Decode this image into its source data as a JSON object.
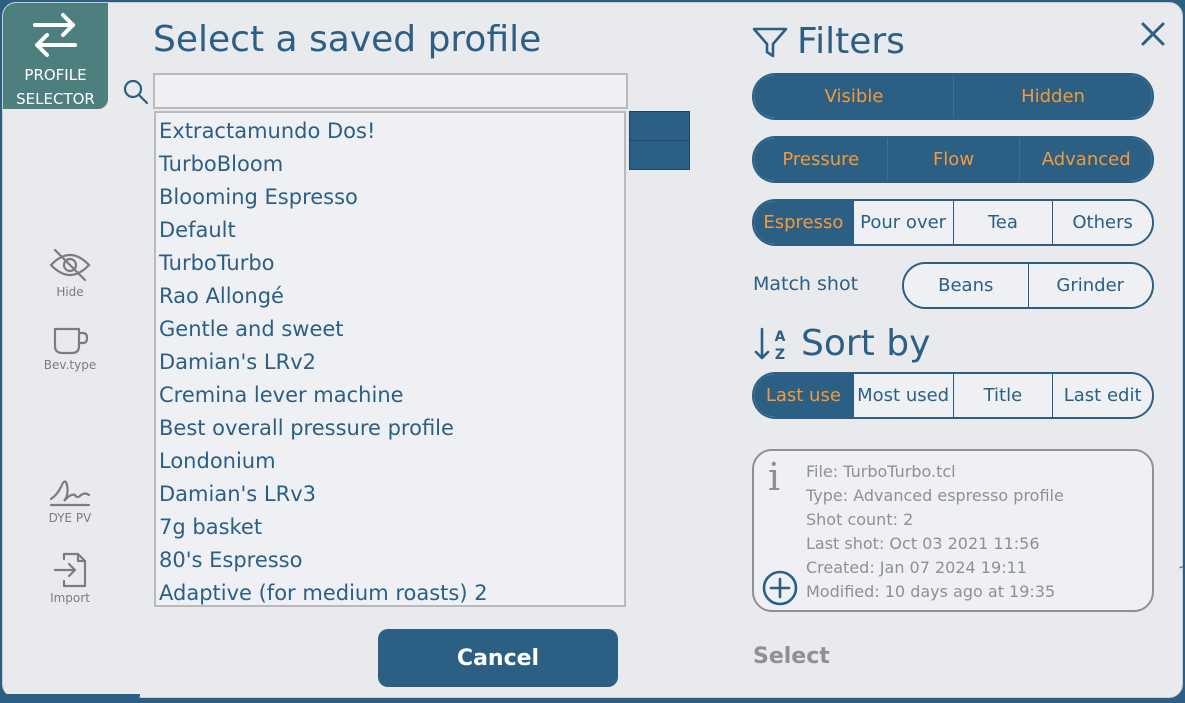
{
  "profile_selector": {
    "label": "PROFILE\nSELECTOR",
    "icon": "swap-arrows-icon"
  },
  "title": "Select a saved profile",
  "search": {
    "value": "",
    "placeholder": ""
  },
  "profiles": [
    "Extractamundo Dos!",
    "TurboBloom",
    "Blooming Espresso",
    "Default",
    "TurboTurbo",
    "Rao Allongé",
    "Gentle and sweet",
    "Damian's LRv2",
    "Cremina lever machine",
    "Best overall pressure profile",
    "Londonium",
    "Damian's LRv3",
    "7g basket",
    "80's Espresso",
    "Adaptive (for medium roasts) 2"
  ],
  "tools": {
    "hide": "Hide",
    "bev_type": "Bev.type",
    "dye_pv": "DYE PV",
    "import": "Import"
  },
  "buttons": {
    "cancel": "Cancel",
    "select": "Select"
  },
  "filters": {
    "title": "Filters",
    "visibility": [
      "Visible",
      "Hidden"
    ],
    "profile_type": [
      "Pressure",
      "Flow",
      "Advanced"
    ],
    "beverage": [
      {
        "label": "Espresso",
        "selected": true
      },
      {
        "label": "Pour over",
        "selected": false
      },
      {
        "label": "Tea",
        "selected": false
      },
      {
        "label": "Others",
        "selected": false
      }
    ],
    "match_shot_label": "Match shot",
    "match_shot": [
      "Beans",
      "Grinder"
    ]
  },
  "sort": {
    "title": "Sort by",
    "options": [
      {
        "label": "Last use",
        "selected": true
      },
      {
        "label": "Most used",
        "selected": false
      },
      {
        "label": "Title",
        "selected": false
      },
      {
        "label": "Last edit",
        "selected": false
      }
    ]
  },
  "info": {
    "file": "File: TurboTurbo.tcl",
    "type": "Type: Advanced espresso profile",
    "shot_count": "Shot count: 2",
    "last_shot": "Last shot: Oct 03 2021 11:56",
    "created": "Created: Jan 07 2024 19:11",
    "modified": "Modified: 10 days ago at 19:35"
  },
  "colors": {
    "primary": "#2c5f84",
    "accent": "#f39a3a",
    "muted": "#8e9095",
    "background": "#e9eaee"
  }
}
